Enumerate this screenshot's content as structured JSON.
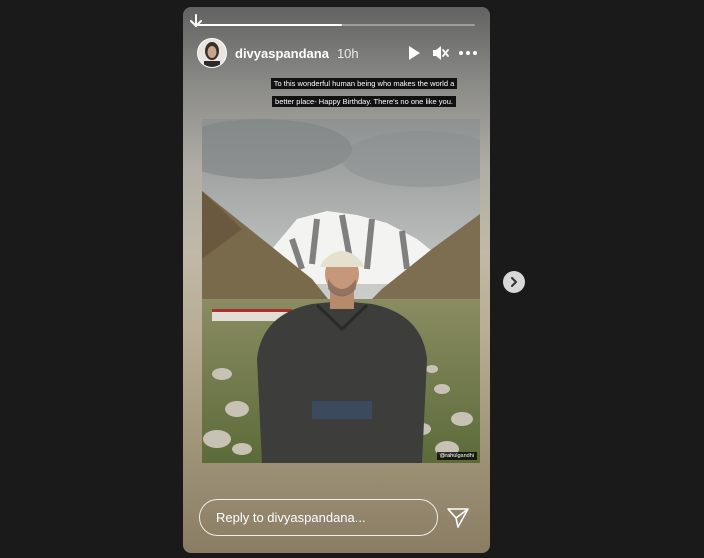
{
  "story": {
    "progress_fraction": 0.52,
    "user": {
      "username": "divyaspandana",
      "time_ago": "10h"
    },
    "controls": {
      "play_icon": "play-icon",
      "mute_icon": "mute-icon",
      "more_icon": "more-options-icon"
    },
    "caption_text": "To this wonderful human being who makes the world a better place- Happy Birthday. There's no one like you.",
    "photo": {
      "credit_tag": "@rahulgandhi"
    },
    "reply": {
      "placeholder": "Reply to divyaspandana..."
    },
    "send_icon": "send-icon"
  },
  "navigation": {
    "next_icon": "chevron-right-icon"
  }
}
